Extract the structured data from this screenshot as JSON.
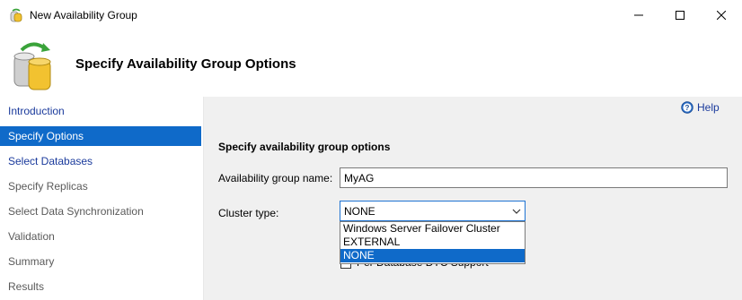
{
  "window": {
    "title": "New Availability Group",
    "icons": {
      "app": "availability-group-icon",
      "minimize": "minimize-icon",
      "maximize": "maximize-icon",
      "close": "close-icon"
    }
  },
  "header": {
    "title": "Specify Availability Group Options",
    "icon": "database-sync-icon"
  },
  "sidebar": {
    "items": [
      {
        "label": "Introduction"
      },
      {
        "label": "Specify Options"
      },
      {
        "label": "Select Databases"
      },
      {
        "label": "Specify Replicas"
      },
      {
        "label": "Select Data Synchronization"
      },
      {
        "label": "Validation"
      },
      {
        "label": "Summary"
      },
      {
        "label": "Results"
      }
    ],
    "active_index": 1
  },
  "main": {
    "help_label": "Help",
    "section_title": "Specify availability group options",
    "name_label": "Availability group name:",
    "name_value": "MyAG",
    "cluster_label": "Cluster type:",
    "cluster_selected": "NONE",
    "cluster_options": [
      "Windows Server Failover Cluster",
      "EXTERNAL",
      "NONE"
    ],
    "dtc_label": "Per Database DTC Support"
  },
  "colors": {
    "accent": "#0f6ac9",
    "link": "#1a3a9c",
    "panel_bg": "#f0f0f0"
  }
}
